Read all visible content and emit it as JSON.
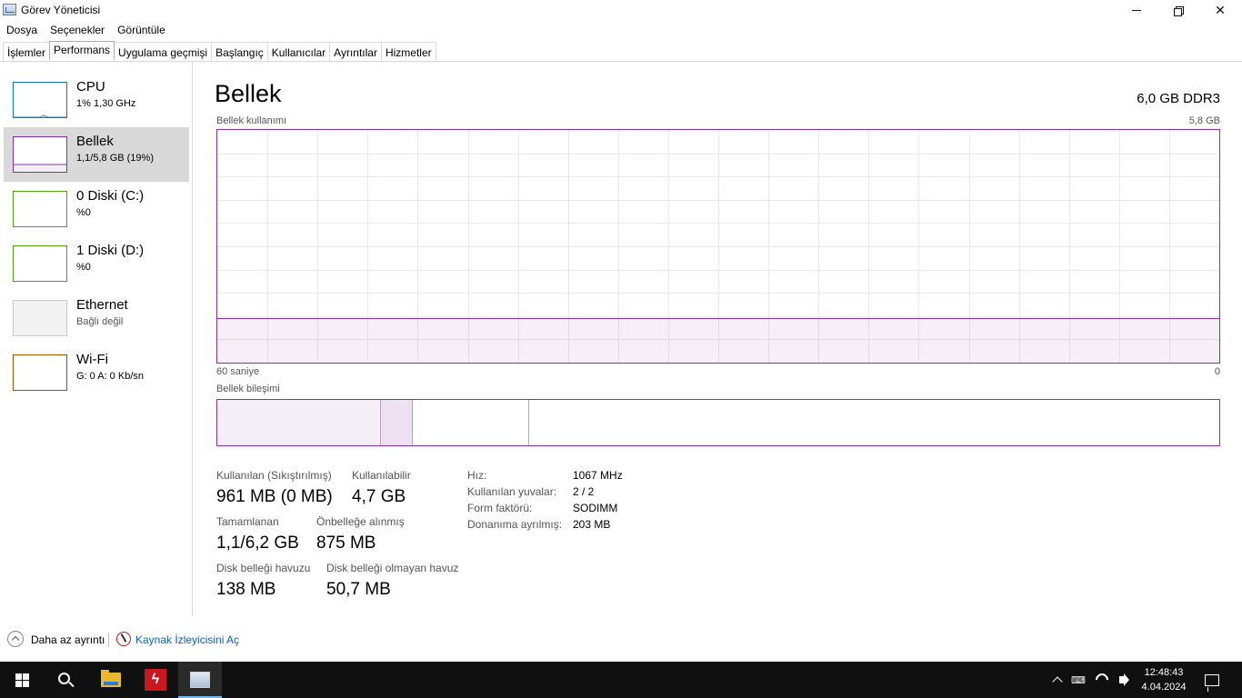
{
  "window": {
    "title": "Görev Yöneticisi"
  },
  "menu": [
    "Dosya",
    "Seçenekler",
    "Görüntüle"
  ],
  "tabs": [
    {
      "label": "İşlemler",
      "active": false
    },
    {
      "label": "Performans",
      "active": true
    },
    {
      "label": "Uygulama geçmişi",
      "active": false
    },
    {
      "label": "Başlangıç",
      "active": false
    },
    {
      "label": "Kullanıcılar",
      "active": false
    },
    {
      "label": "Ayrıntılar",
      "active": false
    },
    {
      "label": "Hizmetler",
      "active": false
    }
  ],
  "sidebar": {
    "items": [
      {
        "name": "CPU",
        "value": "1%  1,30 GHz",
        "color": "#1779ba",
        "selected": false
      },
      {
        "name": "Bellek",
        "value": "1,1/5,8 GB (19%)",
        "color": "#8b2fa8",
        "selected": true
      },
      {
        "name": "0 Diski (C:)",
        "value": "%0",
        "color": "#4da60c",
        "selected": false
      },
      {
        "name": "1 Diski (D:)",
        "value": "%0",
        "color": "#4da60c",
        "selected": false
      },
      {
        "name": "Ethernet",
        "value": "Bağlı değil",
        "color": "#c8c8c8",
        "selected": false
      },
      {
        "name": "Wi-Fi",
        "value": "G: 0 A: 0 Kb/sn",
        "color": "#a74f01",
        "selected": false
      }
    ]
  },
  "main": {
    "title": "Bellek",
    "spec": "6,0 GB DDR3",
    "usage_caption": "Bellek kullanımı",
    "usage_max": "5,8 GB",
    "time_left": "60 saniye",
    "time_right": "0",
    "composition_caption": "Bellek bileşimi",
    "usage_fraction": 0.19,
    "accent_color": "#8b2fa8"
  },
  "stats": {
    "in_use_label": "Kullanılan (Sıkıştırılmış)",
    "in_use_value": "961 MB (0 MB)",
    "available_label": "Kullanılabilir",
    "available_value": "4,7 GB",
    "committed_label": "Tamamlanan",
    "committed_value": "1,1/6,2 GB",
    "cached_label": "Önbelleğe alınmış",
    "cached_value": "875 MB",
    "paged_label": "Disk belleği havuzu",
    "paged_value": "138 MB",
    "nonpaged_label": "Disk belleği olmayan havuz",
    "nonpaged_value": "50,7 MB"
  },
  "info": {
    "speed_label": "Hız:",
    "speed_value": "1067 MHz",
    "slots_label": "Kullanılan yuvalar:",
    "slots_value": "2 / 2",
    "form_label": "Form faktörü:",
    "form_value": "SODIMM",
    "reserved_label": "Donanıma ayrılmış:",
    "reserved_value": "203 MB"
  },
  "footer": {
    "fewer_details": "Daha az ayrıntı",
    "resource_monitor": "Kaynak İzleyicisini Aç"
  },
  "taskbar": {
    "time": "12:48:43",
    "date": "4.04.2024"
  }
}
